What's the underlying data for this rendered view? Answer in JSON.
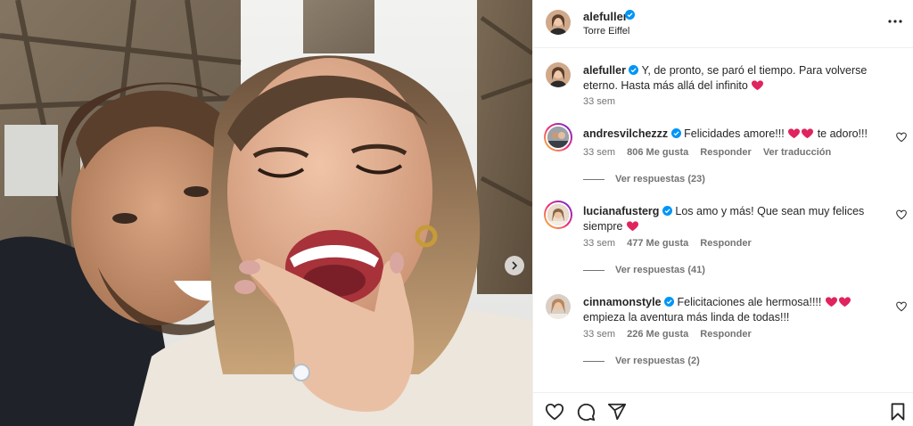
{
  "post": {
    "username": "alefuller",
    "verified": true,
    "location": "Torre Eiffel",
    "more_icon": "more-horizontal-icon"
  },
  "caption": {
    "username": "alefuller",
    "text": "Y, de pronto, se paró el tiempo. Para volverse eterno. Hasta más allá del infinito",
    "emoji": "red-heart",
    "time": "33 sem"
  },
  "comments": [
    {
      "username": "andresvilchezzz",
      "verified": true,
      "text_before": "Felicidades amore!!!",
      "text_after": "te adoro!!!",
      "hearts_between": 2,
      "time": "33 sem",
      "likes": "806 Me gusta",
      "reply_label": "Responder",
      "translate_label": "Ver traducción",
      "replies_label": "Ver respuestas (23)"
    },
    {
      "username": "lucianafusterg",
      "verified": true,
      "text_before": "Los amo y más! Que sean muy felices siempre",
      "text_after": "",
      "hearts_between": 1,
      "time": "33 sem",
      "likes": "477 Me gusta",
      "reply_label": "Responder",
      "replies_label": "Ver respuestas (41)"
    },
    {
      "username": "cinnamonstyle",
      "verified": true,
      "text_before": "Felicitaciones ale hermosa!!!!",
      "text_after": "empieza la aventura más linda de todas!!!",
      "hearts_between": 2,
      "time": "33 sem",
      "likes": "226 Me gusta",
      "reply_label": "Responder",
      "replies_label": "Ver respuestas (2)"
    }
  ],
  "actions": {
    "like_icon": "heart-outline-icon",
    "comment_icon": "comment-bubble-icon",
    "share_icon": "paper-plane-icon",
    "save_icon": "bookmark-icon"
  },
  "colors": {
    "verified_blue": "#0095f6",
    "heart_red": "#e0245e",
    "muted_text": "#737373",
    "primary_text": "#262626"
  }
}
